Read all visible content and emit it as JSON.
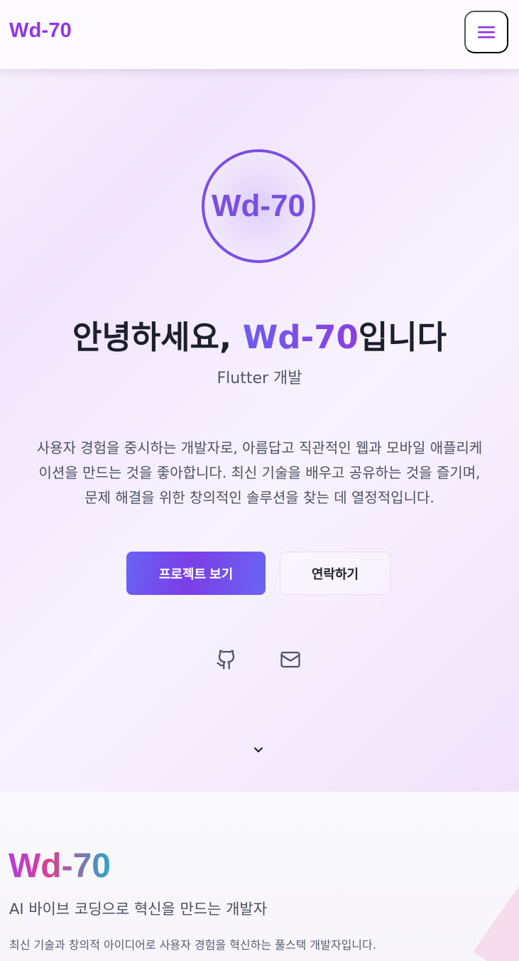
{
  "header": {
    "logo": "Wd-70",
    "menu_icon": "hamburger-menu-icon"
  },
  "hero": {
    "avatar_text": "Wd-70",
    "title_prefix": "안녕하세요, ",
    "title_name": "Wd-70",
    "title_suffix": "입니다",
    "subtitle": "Flutter 개발",
    "description_lines": [
      "사용자 경험을 중시하는 개발자로, 아름답고 직관적인 웹과 모바일 애플리케",
      "이션을 만드는 것을 좋아합니다. 최신 기술을 배우고 공유하는 것을 즐기며,",
      "문제 해결을 위한 창의적인 솔루션을 찾는 데 열정적입니다."
    ],
    "primary_button": "프로젝트 보기",
    "secondary_button": "연락하기",
    "social": [
      {
        "icon": "github-icon"
      },
      {
        "icon": "mail-icon"
      }
    ],
    "scroll_icon": "chevron-down-icon"
  },
  "about": {
    "title": "Wd-70",
    "subtitle": "AI 바이브 코딩으로 혁신을 만드는 개발자",
    "description": "최신 기술과 창의적 아이디어로 사용자 경험을 혁신하는 풀스택 개발자입니다."
  },
  "colors": {
    "brand": "#9333ea",
    "accent": "#7c4ee6",
    "primary_button": "#6d5cf2"
  }
}
